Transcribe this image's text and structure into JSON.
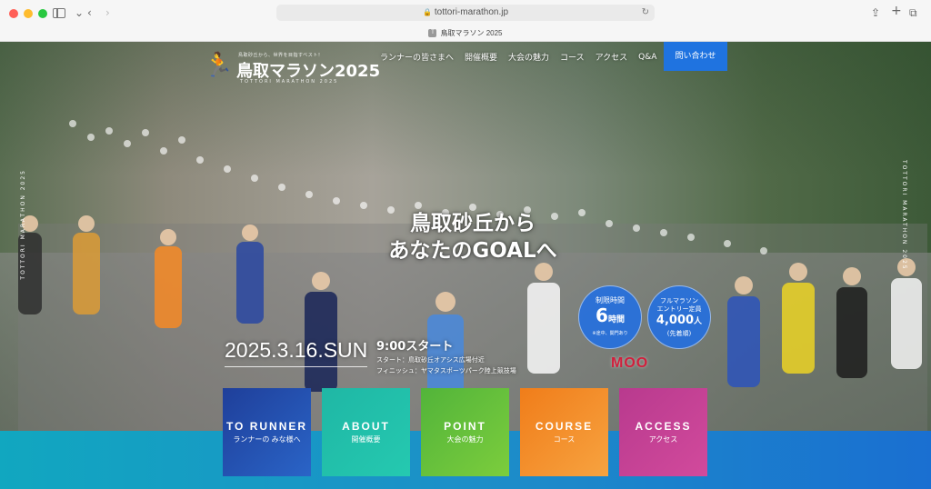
{
  "browser": {
    "url": "tottori-marathon.jp",
    "tab_title": "鳥取マラソン 2025",
    "tab_favicon": "T"
  },
  "header": {
    "logo_tagline": "鳥取砂丘から、世界を目指すベスト！",
    "logo_title": "鳥取マラソン2025",
    "logo_sub": "TOTTORI MARATHON 2025",
    "nav": [
      "ランナーの皆さまへ",
      "開催概要",
      "大会の魅力",
      "コース",
      "アクセス",
      "Q&A"
    ],
    "contact_label": "問い合わせ"
  },
  "side_text": "TOTTORI MARATHON 2025",
  "hero": {
    "headline_line1": "鳥取砂丘から",
    "headline_line2": "あなたのGOALへ",
    "date": "2025.3.16.SUN",
    "start_time": "9:00スタート",
    "start_location": "スタート：鳥取砂丘オアシス広場付近",
    "finish_location": "フィニッシュ：ヤマタスポーツパーク陸上競技場",
    "sponsor": "MOO"
  },
  "badges": {
    "limit_label": "制限時間",
    "limit_value": "6",
    "limit_unit": "時間",
    "limit_note": "※途中、関門あり",
    "entry_label_1": "フルマラソン",
    "entry_label_2": "エントリー定員",
    "entry_value": "4,000",
    "entry_unit": "人",
    "entry_note": "(先着順)"
  },
  "cards": [
    {
      "en": "TO RUNNER",
      "ja": "ランナーの みな様へ"
    },
    {
      "en": "ABOUT",
      "ja": "開催概要"
    },
    {
      "en": "POINT",
      "ja": "大会の魅力"
    },
    {
      "en": "COURSE",
      "ja": "コース"
    },
    {
      "en": "ACCESS",
      "ja": "アクセス"
    }
  ],
  "colors": {
    "contact_bg": "#1f73e0",
    "badge_bg": "#1e6ee6",
    "card_runner": "#1f3f9a",
    "card_about": "#1fb7a5",
    "card_point": "#52b43a",
    "card_course": "#f07d1a",
    "card_access": "#b83a8e"
  }
}
